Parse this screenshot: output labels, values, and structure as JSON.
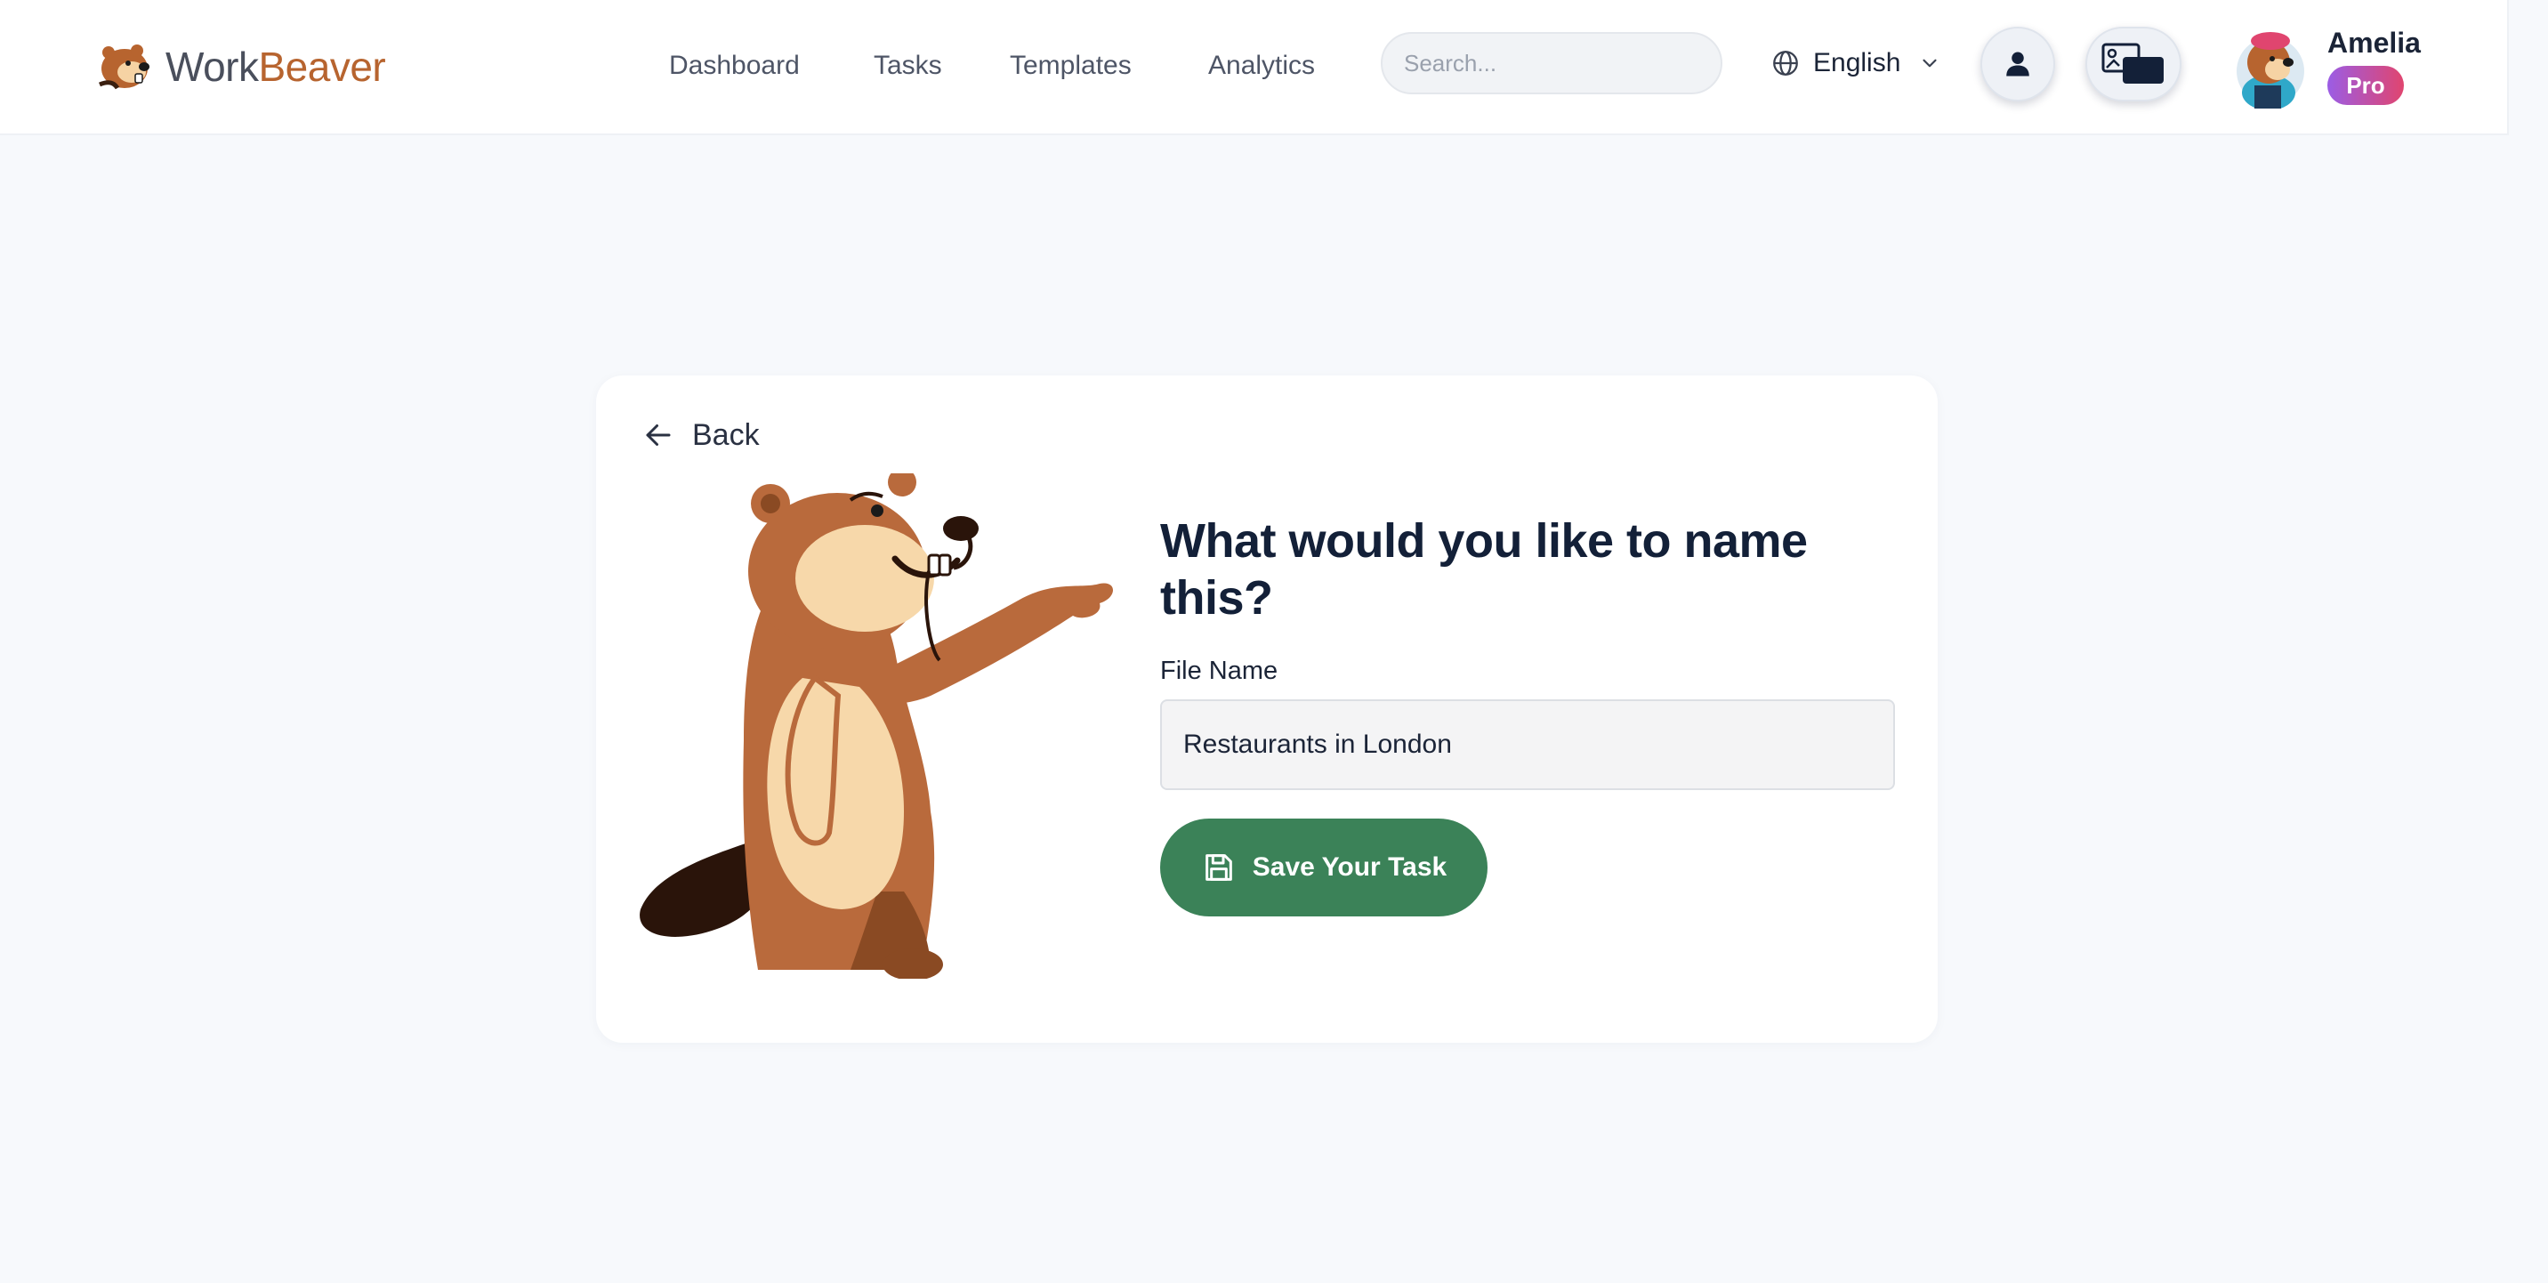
{
  "header": {
    "logo": {
      "work": "Work",
      "beaver": "Beaver"
    },
    "nav": [
      {
        "label": "Dashboard"
      },
      {
        "label": "Tasks"
      },
      {
        "label": "Templates"
      },
      {
        "label": "Analytics"
      }
    ],
    "search": {
      "placeholder": "Search...",
      "value": ""
    },
    "language": {
      "selected": "English"
    },
    "user": {
      "name": "Amelia",
      "badge": "Pro"
    }
  },
  "card": {
    "back_label": "Back",
    "title": "What would you like to name this?",
    "field_label": "File Name",
    "file_name_value": "Restaurants in London",
    "save_label": "Save Your Task"
  },
  "colors": {
    "brand": "#b7642f",
    "primary_button": "#3b8258",
    "pro_badge_from": "#9b5de5",
    "pro_badge_to": "#e0456f",
    "heading": "#132038",
    "page_background": "#f7f9fc"
  },
  "icons": {
    "logo": "beaver-logo-icon",
    "search": "search-icon",
    "language": "globe-icon",
    "dropdown": "chevron-down-icon",
    "profile": "user-icon",
    "screen": "screen-share-icon",
    "back": "arrow-left-icon",
    "save": "floppy-disk-icon"
  }
}
